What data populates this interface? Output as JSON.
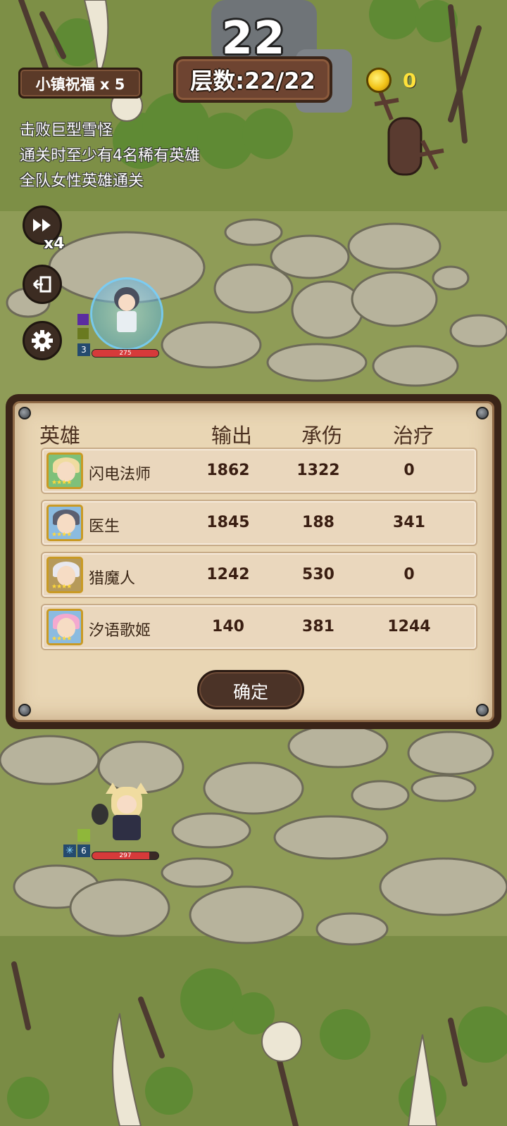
{
  "hud": {
    "round": "22",
    "floor": "层数:22/22",
    "blessing": "小镇祝福 x 5",
    "coins": "0"
  },
  "objectives": [
    "击败巨型雪怪",
    "通关时至少有4名稀有英雄",
    "全队女性英雄通关"
  ],
  "controls": {
    "speed_label": "x4"
  },
  "units": {
    "top_hero": {
      "hp": "275",
      "level": "3"
    },
    "bottom_hero": {
      "hp": "297",
      "level": "6"
    }
  },
  "results": {
    "headers": {
      "hero": "英雄",
      "damage": "输出",
      "tank": "承伤",
      "heal": "治疗"
    },
    "rows": [
      {
        "name": "闪电法师",
        "damage": "1862",
        "tank": "1322",
        "heal": "0",
        "hair": "#f0dca0",
        "frame": "#7ec07a"
      },
      {
        "name": "医生",
        "damage": "1845",
        "tank": "188",
        "heal": "341",
        "hair": "#5a5f70",
        "frame": "#8bbbe0"
      },
      {
        "name": "猎魔人",
        "damage": "1242",
        "tank": "530",
        "heal": "0",
        "hair": "#e8e8ee",
        "frame": "#b69a5a"
      },
      {
        "name": "汐语歌姬",
        "damage": "140",
        "tank": "381",
        "heal": "1244",
        "hair": "#f3a9cf",
        "frame": "#8bbbe0"
      }
    ],
    "confirm_label": "确定"
  }
}
